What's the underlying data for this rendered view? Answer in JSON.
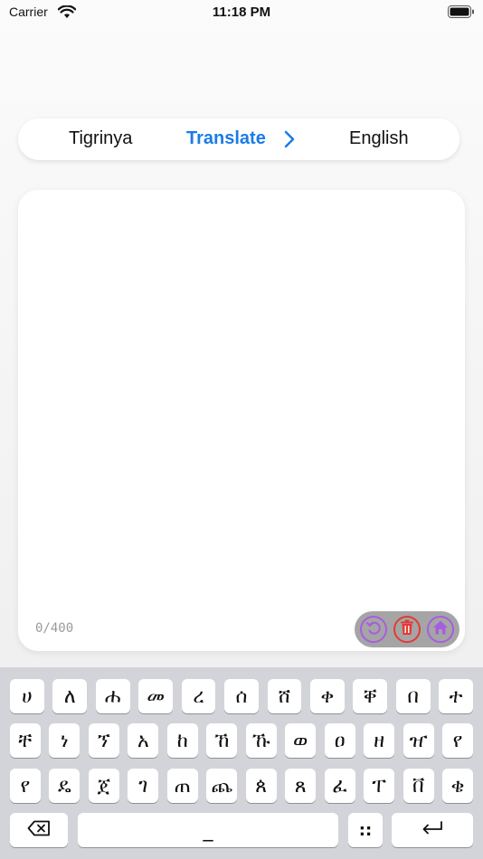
{
  "status_bar": {
    "carrier": "Carrier",
    "time": "11:18 PM"
  },
  "language_bar": {
    "source_language": "Tigrinya",
    "action_label": "Translate",
    "target_language": "English",
    "accent_color": "#1a7ce6"
  },
  "editor": {
    "text": "",
    "char_count": "0/400"
  },
  "actions": {
    "undo_icon": "undo-icon",
    "delete_icon": "trash-icon",
    "home_icon": "home-icon",
    "undo_color": "#a85de0",
    "delete_color": "#e53935",
    "home_color": "#a85de0"
  },
  "keyboard": {
    "rows": [
      [
        "ሀ",
        "ለ",
        "ሐ",
        "መ",
        "ረ",
        "ሰ",
        "ሸ",
        "ቀ",
        "ቐ",
        "በ",
        "ተ"
      ],
      [
        "ቸ",
        "ነ",
        "ኘ",
        "አ",
        "ከ",
        "ኸ",
        "ኹ",
        "ወ",
        "ዐ",
        "ዘ",
        "ዠ",
        "የ"
      ],
      [
        "የ",
        "ዴ",
        "ጀ",
        "ገ",
        "ጠ",
        "ጨ",
        "ጰ",
        "ጸ",
        "ፈ",
        "ፐ",
        "ቨ",
        "ቄ"
      ]
    ],
    "space_label": "_",
    "punct_label": "::",
    "backspace_icon": "backspace-icon",
    "return_icon": "return-icon"
  }
}
